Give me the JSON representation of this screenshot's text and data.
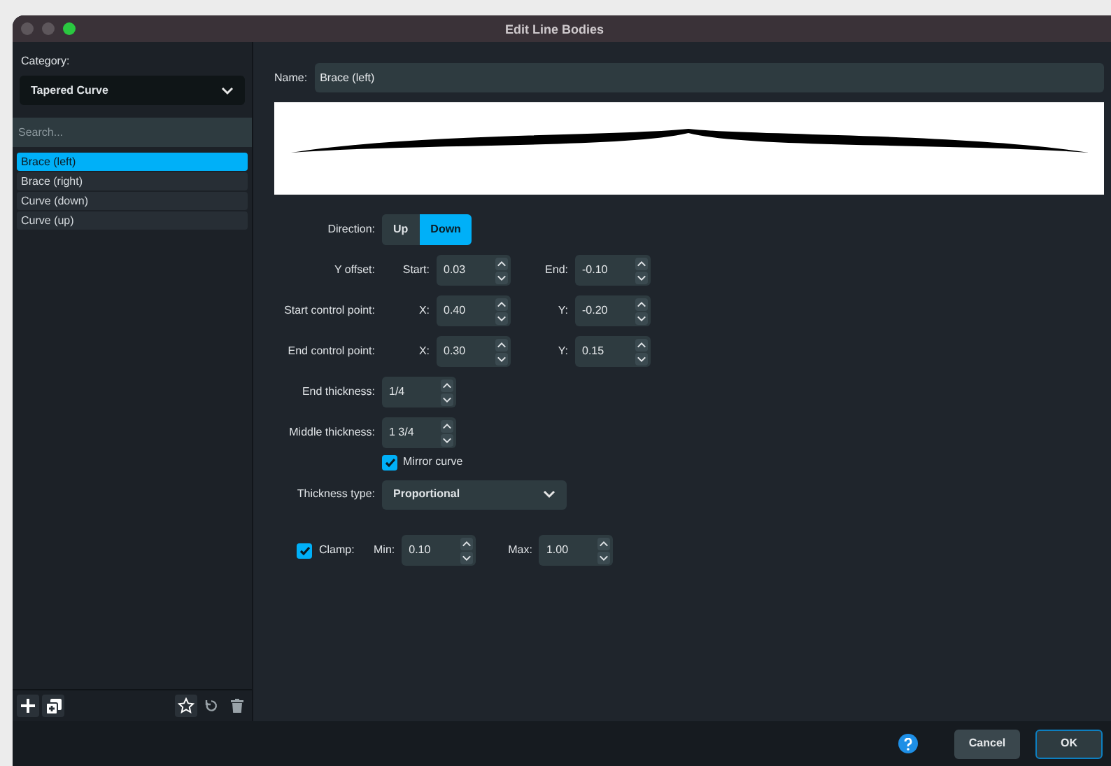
{
  "window": {
    "title": "Edit Line Bodies"
  },
  "sidebar": {
    "category_label": "Category:",
    "category_value": "Tapered Curve",
    "search_placeholder": "Search...",
    "items": [
      {
        "label": "Brace (left)",
        "selected": true
      },
      {
        "label": "Brace (right)",
        "selected": false
      },
      {
        "label": "Curve (down)",
        "selected": false
      },
      {
        "label": "Curve (up)",
        "selected": false
      }
    ]
  },
  "name": {
    "label": "Name:",
    "value": "Brace (left)"
  },
  "direction": {
    "label": "Direction:",
    "options": [
      {
        "label": "Up",
        "selected": false
      },
      {
        "label": "Down",
        "selected": true
      }
    ]
  },
  "point_rows": [
    {
      "label": "Y offset:",
      "a": {
        "label": "Start:",
        "value": "0.03"
      },
      "b": {
        "label": "End:",
        "value": "-0.10"
      }
    },
    {
      "label": "Start control point:",
      "a": {
        "label": "X:",
        "value": "0.40"
      },
      "b": {
        "label": "Y:",
        "value": "-0.20"
      }
    },
    {
      "label": "End control point:",
      "a": {
        "label": "X:",
        "value": "0.30"
      },
      "b": {
        "label": "Y:",
        "value": "0.15"
      }
    }
  ],
  "thickness_rows": [
    {
      "label": "End thickness:",
      "value": "1/4"
    },
    {
      "label": "Middle thickness:",
      "value": "1 3/4"
    }
  ],
  "mirror_curve": {
    "label": "Mirror curve",
    "checked": true
  },
  "thickness_type": {
    "label": "Thickness type:",
    "value": "Proportional"
  },
  "clamp": {
    "label": "Clamp:",
    "checked": true,
    "min": {
      "label": "Min:",
      "value": "0.10"
    },
    "max": {
      "label": "Max:",
      "value": "1.00"
    }
  },
  "buttons": [
    {
      "label": "Cancel",
      "kind": "secondary"
    },
    {
      "label": "OK",
      "kind": "default"
    }
  ]
}
